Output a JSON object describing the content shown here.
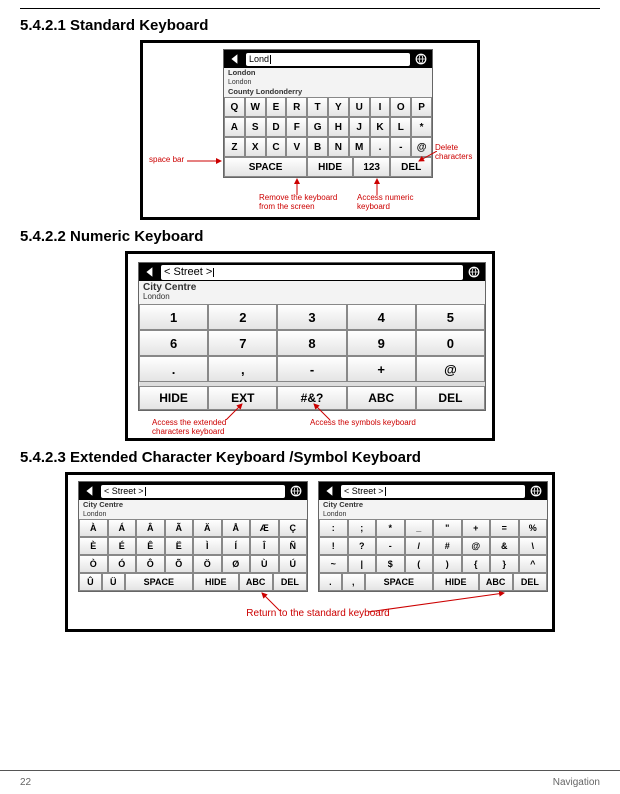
{
  "headings": {
    "h1": "5.4.2.1 Standard Keyboard",
    "h2": "5.4.2.2 Numeric Keyboard",
    "h3": "5.4.2.3 Extended Character Keyboard /Symbol Keyboard"
  },
  "footer": {
    "page": "22",
    "section": "Navigation"
  },
  "fig1": {
    "input": "Lond",
    "suggestions": [
      "London",
      "London",
      "County Londonderry"
    ],
    "row1": [
      "Q",
      "W",
      "E",
      "R",
      "T",
      "Y",
      "U",
      "I",
      "O",
      "P"
    ],
    "row2": [
      "A",
      "S",
      "D",
      "F",
      "G",
      "H",
      "J",
      "K",
      "L",
      "*"
    ],
    "row3": [
      "Z",
      "X",
      "C",
      "V",
      "B",
      "N",
      "M",
      ".",
      "-",
      "@"
    ],
    "func": [
      "SPACE",
      "HIDE",
      "123",
      "DEL"
    ],
    "callouts": {
      "space": "space bar",
      "hide": "Remove the keyboard from the screen",
      "num": "Access numeric keyboard",
      "del": "Delete characters"
    }
  },
  "fig2": {
    "input": "< Street >",
    "suggTitle": "City Centre",
    "suggSub": "London",
    "row1": [
      "1",
      "2",
      "3",
      "4",
      "5"
    ],
    "row2": [
      "6",
      "7",
      "8",
      "9",
      "0"
    ],
    "row3": [
      ".",
      ",",
      "-",
      "+",
      "@"
    ],
    "func": [
      "HIDE",
      "EXT",
      "#&?",
      "ABC",
      "DEL"
    ],
    "callouts": {
      "ext": "Access the extended characters keyboard",
      "sym": "Access the symbols keyboard"
    }
  },
  "fig3": {
    "input": "< Street >",
    "suggTitle": "City Centre",
    "suggSub": "London",
    "ext": {
      "r1": [
        "À",
        "Á",
        "Â",
        "Ã",
        "Ä",
        "Å",
        "Æ",
        "Ç"
      ],
      "r2": [
        "È",
        "É",
        "Ê",
        "Ë",
        "Ì",
        "Í",
        "Î",
        "Ñ"
      ],
      "r3": [
        "Ò",
        "Ó",
        "Ô",
        "Õ",
        "Ö",
        "Ø",
        "Ù",
        "Ú"
      ],
      "func": [
        "Û",
        "Ü",
        "SPACE",
        "HIDE",
        "ABC",
        "DEL"
      ]
    },
    "sym": {
      "r1": [
        ":",
        ";",
        "*",
        "_",
        "\"",
        "+",
        "=",
        "%"
      ],
      "r2": [
        "!",
        "?",
        "-",
        "/",
        "#",
        "@",
        "&",
        "\\"
      ],
      "r3": [
        "~",
        "|",
        "$",
        "(",
        ")",
        "{",
        "}",
        "^"
      ],
      "func": [
        ".",
        ",",
        "SPACE",
        "HIDE",
        "ABC",
        "DEL"
      ]
    },
    "callout": "Return to the standard keyboard"
  }
}
